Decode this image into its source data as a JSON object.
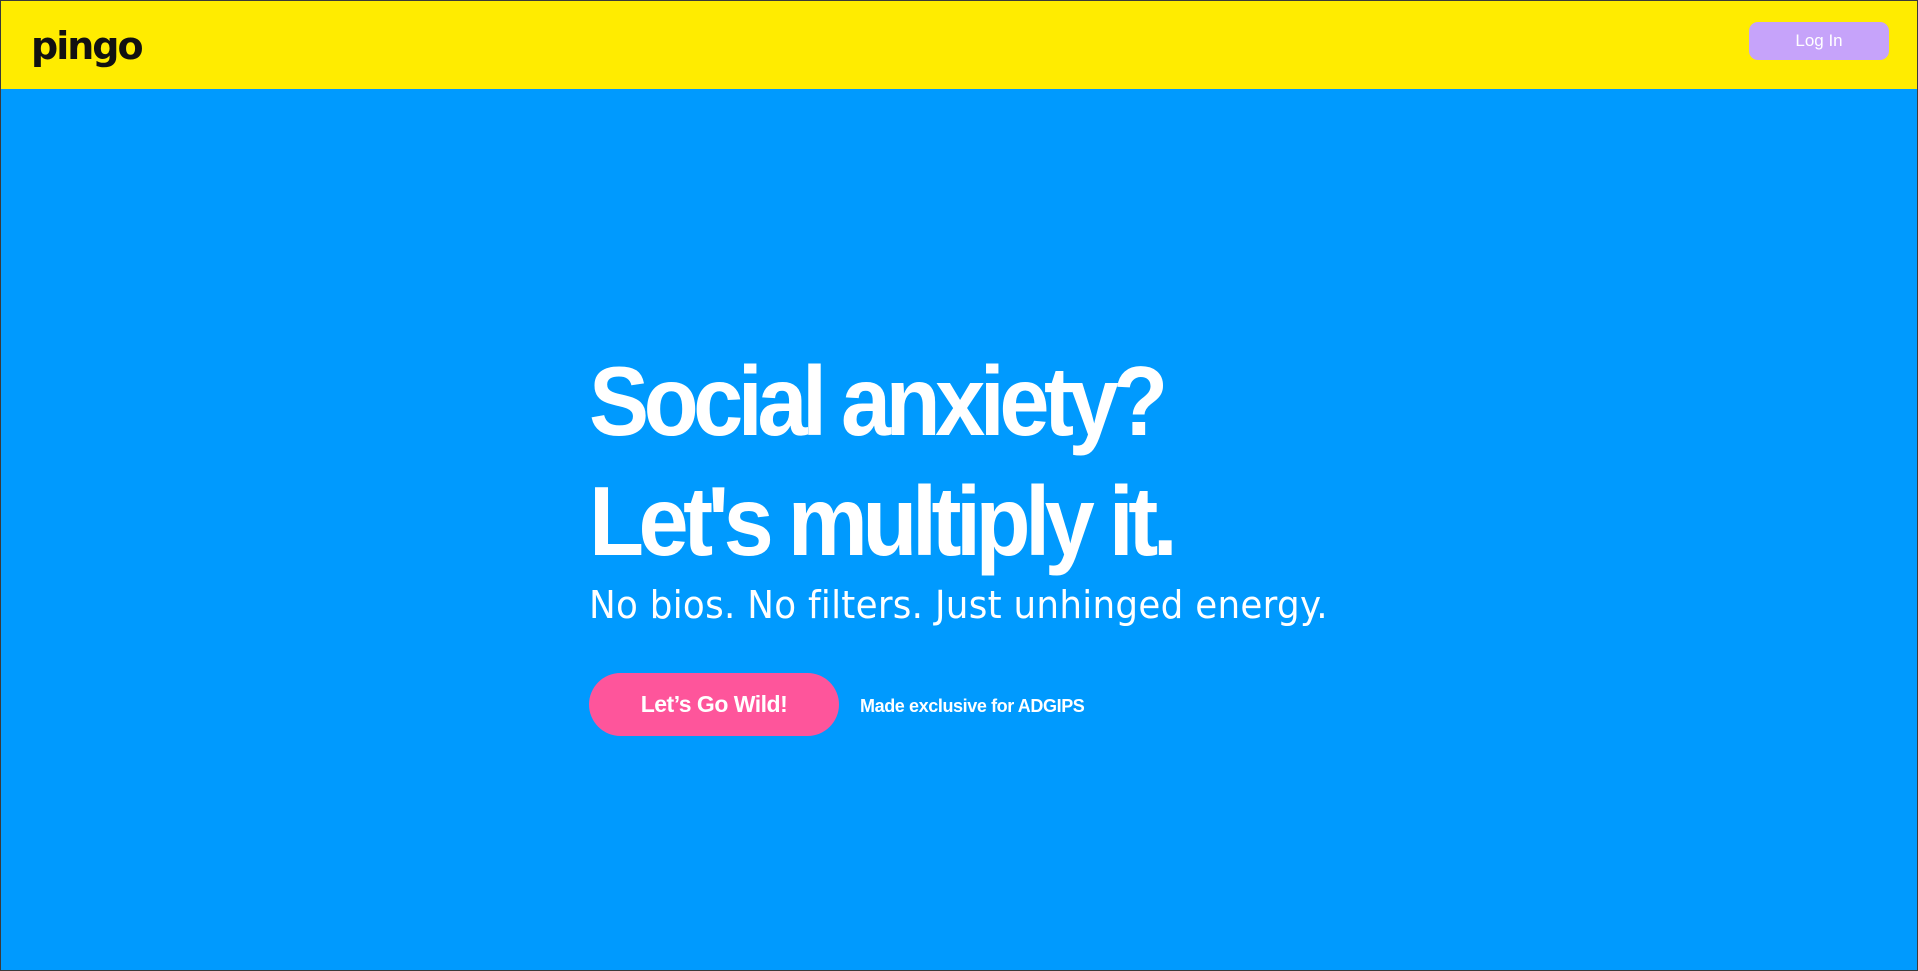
{
  "header": {
    "logo_text": "pingo",
    "login_label": "Log In"
  },
  "hero": {
    "headline_line1": "Social anxiety?",
    "headline_line2": "Let's multiply it.",
    "subtitle": "No bios. No filters. Just unhinged energy.",
    "cta_label": "Let’s Go Wild!",
    "exclusive_note": "Made exclusive for ADGIPS"
  },
  "colors": {
    "header_bg": "#FFEC00",
    "page_bg": "#009AFE",
    "login_button": "#C6A3FA",
    "cta_button": "#FE559B",
    "text": "#FFFFFF"
  }
}
